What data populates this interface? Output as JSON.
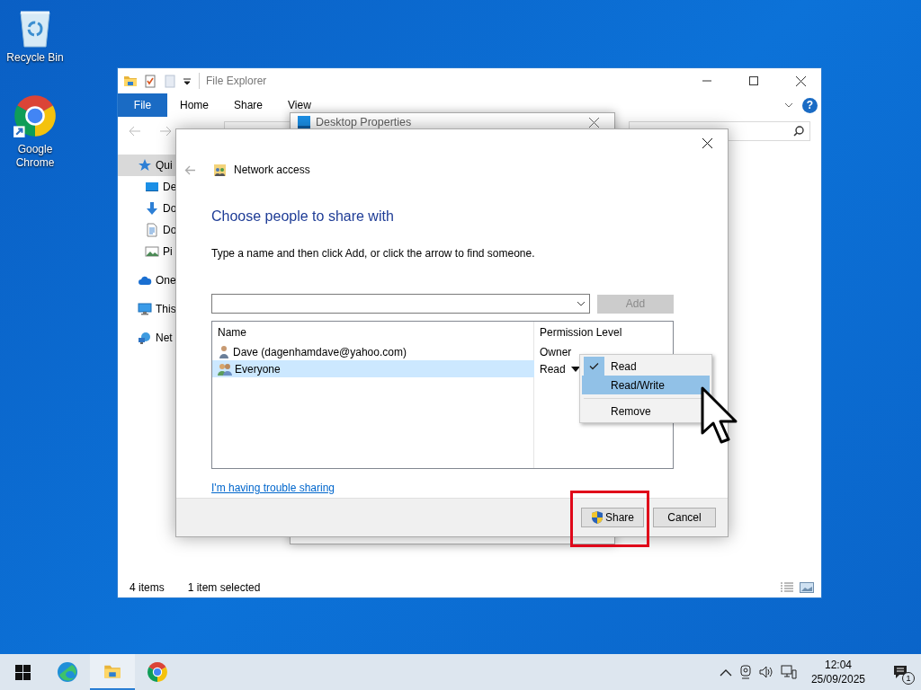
{
  "desktop_icons": [
    {
      "label": "Recycle Bin",
      "kind": "recycle"
    },
    {
      "label": "Google Chrome",
      "kind": "chrome"
    }
  ],
  "explorer": {
    "title": "File Explorer",
    "file_tab": "File",
    "tabs": [
      {
        "label": "Home"
      },
      {
        "label": "Share"
      },
      {
        "label": "View"
      }
    ],
    "help": "?",
    "sidebar": [
      {
        "label": "Qui",
        "kind": "star",
        "selected": true,
        "children": [
          {
            "label": "De",
            "kind": "desktop",
            "selected": false
          },
          {
            "label": "Do",
            "kind": "download",
            "selected": false
          },
          {
            "label": "Do",
            "kind": "document",
            "selected": false
          },
          {
            "label": "Pi",
            "kind": "pictures",
            "selected": false
          }
        ]
      },
      {
        "label": "One",
        "kind": "cloud",
        "selected": false
      },
      {
        "label": "This",
        "kind": "pc",
        "selected": false
      },
      {
        "label": "Net",
        "kind": "network",
        "selected": false
      }
    ],
    "status_bar": {
      "count": "4 items",
      "selection": "1 item selected"
    }
  },
  "properties_window": {
    "title": "Desktop Properties"
  },
  "dialog": {
    "title": "Network access",
    "heading": "Choose people to share with",
    "instructions": "Type a name and then click Add, or click the arrow to find someone.",
    "add_button": {
      "label": "Add",
      "disabled": true
    },
    "table": {
      "columns": [
        "Name",
        "Permission Level"
      ],
      "rows": [
        {
          "name": "Dave (dagenhamdave@yahoo.com)",
          "kind": "user",
          "permission": "Owner",
          "selected": false,
          "has_menu": false
        },
        {
          "name": "Everyone",
          "kind": "group",
          "permission": "Read",
          "selected": true,
          "has_menu": true
        }
      ]
    },
    "permission_menu": [
      {
        "label": "Read",
        "checked": true,
        "selected": false,
        "separated": false
      },
      {
        "label": "Read/Write",
        "checked": false,
        "selected": true,
        "separated": false
      },
      {
        "label": "Remove",
        "checked": false,
        "selected": false,
        "separated": true
      }
    ],
    "help_link": "I'm having trouble sharing",
    "buttons": [
      {
        "label": "Share",
        "kind": "shield"
      },
      {
        "label": "Cancel",
        "kind": "plain"
      }
    ],
    "first_button_framed": true
  },
  "taskbar": {
    "apps": [
      {
        "kind": "edge",
        "active": false
      },
      {
        "kind": "explorer",
        "active": true
      },
      {
        "kind": "chrome",
        "active": false
      }
    ],
    "time": "12:04",
    "date": "25/09/2025",
    "notification_count": "1"
  }
}
